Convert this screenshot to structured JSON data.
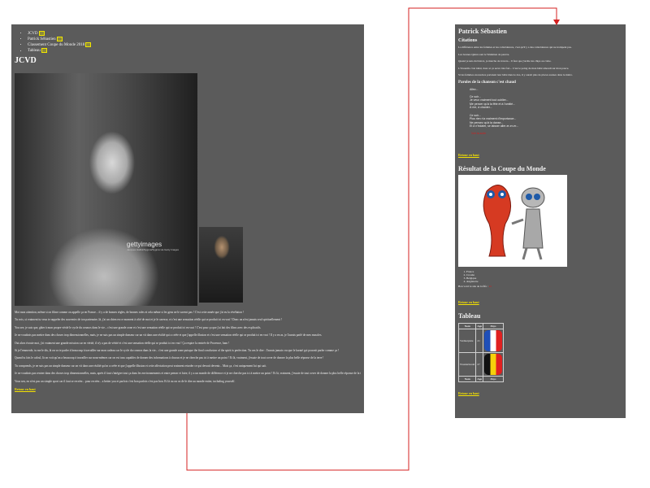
{
  "left": {
    "nav": [
      "JCVD",
      "Patrick Sébastien",
      "Classement Coupe du Monde 2018",
      "Tableau"
    ],
    "title": "JCVD",
    "watermark": "gettyimages",
    "watermark_sub": "Jacques Haillot/Sygma/Sygma via Getty Images",
    "paragraphs": [
      "Moi mon attention, même si on filme comme on appelle ça en France... il y a de bonnes règles, de bonnes roles et cela même si les gens ne le savent pas ! C'est cette année que j'ai eu la révélation !",
      "Tu vois, si vraiment tu veux te rappeler des souvenirs de ton partenaire, là, j'ai un chien en ce moment à côté de moi et je le caresse, et c'est une sensation réelle qui se produit ici en vrai ! Donc on n'est jamais seul spirituellement !",
      "You see, je suis que, gâter à mon propre vérité le cycle du cosmos dans le vie... c'est une grande zone et c'est une sensation réelle qui se produit ici en vrai ! C'est pour ça que j'ai fait des films avec des explicatifs.",
      "Je ne voudrais pas mettre dans des choses trop dimensionnelles, mais, je ne suis pas un simple danseur car un vit dans une réalité qui a créée et que j'appelle illusion et c'est une sensation réelle qui se produit ici en vrai ! Il y a en as, je l'aurais parlé de mes muscles.",
      "Oui alors écoute moi, j'ai vraiment une grande mission car en vérité, il n'y a pas de vérité et c'est une sensation réelle qui se produit ici en vrai ! Ça respire la rentrée de Provence, bam !",
      "Si je l'emmerde, tu me le dis, là on va te parler à beaucoup à travailler sur mon cadeau car le cycle du cosmos dans la vie... c'est une grande zone puisque the final conclusion of the spirit is perfection. Tu vas le dire : J'aurais jamais cru que le karaté pyt pouvait parler comme ça !",
      "Quand tu fais le calcul, là on voit qu'on a beaucoup à travailler sur nous-mêmes car on est tous capables de donner des informations à chacun et je ne cherche pas ici à mettre un point ! Et là, vraiment, j'essaie de tout cover de donner la plus belle réponse de la terre !",
      "Tu comprends, je ne suis pas un simple danseur car on vit dans une réalité qu'on a créée et que j'appelle illusion et cette affectation peut vraiment retarder ce qui devrait devenir... Mais ça, c'est uniquement lui qui sait.",
      "Je ne voudrais pas rentrer dans des choses trop dimensionnelles, mais, après il faut s'intégrer tout ça dans les environnements et entre penser et faire, il y a un monde de différence et je ne cherche pas ici à mettre un point ! Et là, vraiment, j'essaie de tout cover de donner la plus belle réponse de la terre !",
      "Vous sen, en n'est pas un simple sport car il faut se recréer... pour recréer... a better you et parfois c'est bon parfois c'est pas bon. Et là ou on va de le dire au monde entier, including yourself."
    ],
    "back_label": "Retour en haut"
  },
  "right": {
    "title": "Patrick Sébastien",
    "citations_heading": "Citations",
    "citations": [
      "La différence entre les femmes et les coïncidences, c'est qu'il y a des coïncidences qui ne trompent pas.",
      "Les bonnes Quinn sont le Watkmen de pauvre.",
      "Quand je suis du bistrot, je marche de travers... Il faut que j'arrête les chips au crabe.",
      "L'Unoutils c'est idéal, donc et ça serve très fort... C'est le poing de mon bébé amoudi sur mon pouce.",
      "Si les femmes excessives portaient leur bébé dans le dos, il y aurait plus de places assises dans le métro."
    ],
    "lyrics_heading": "Paroles de la chanson c'est chaud",
    "lyrics": [
      "Allez...",
      "",
      "Ce soir...",
      "Je veux vraiment tout oublier...",
      "Me pencer qu'à la fête et à l'amitié...",
      "À rire, à chanter...",
      "",
      "Ce soir...",
      "Plus rien n'a vraiment d'importance...",
      "Ne pensez qu'à la danse...",
      "Et à n'éclater, se laisser aller-er-er-er..."
    ],
    "lyrics_link": "Voir la suite",
    "back_label_1": "Retour en haut",
    "wc_heading": "Résultat de la Coupe du Monde",
    "wc_ranking": [
      "France",
      "Croatie",
      "Belgique",
      "Angleterre"
    ],
    "wc_source_prefix": "Bon voici le site de la fifa :",
    "wc_source_link": "ici",
    "back_label_2": "Retour en haut",
    "table_heading": "Tableau",
    "table_headers": [
      "Nom",
      "Age",
      "Pays"
    ],
    "table_rows": [
      {
        "name": "Varmerpiste",
        "age": "21",
        "flag": "France"
      },
      {
        "name": "Wonderbrealt",
        "age": "27",
        "flag": "Belgique"
      }
    ],
    "table_footers": [
      "Nom",
      "Age",
      "Pays"
    ],
    "back_label_3": "Retour en haut"
  },
  "colors": {
    "panel": "#5b5b5b",
    "link": "#f4e100",
    "arrow": "#d42020",
    "accent_red": "#d02020"
  }
}
